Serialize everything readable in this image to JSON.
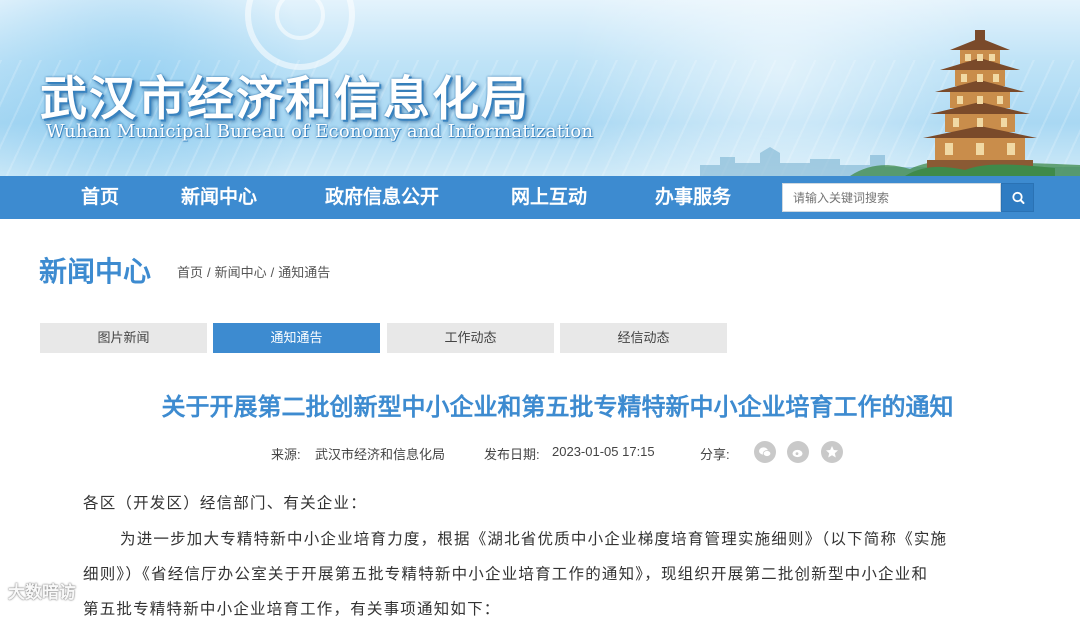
{
  "header": {
    "title": "武汉市经济和信息化局",
    "subtitle": "Wuhan Municipal Bureau of Economy and Informatization"
  },
  "nav": {
    "items": [
      "首页",
      "新闻中心",
      "政府信息公开",
      "网上互动",
      "办事服务"
    ],
    "search_placeholder": "请输入关键词搜索"
  },
  "section": {
    "title": "新闻中心",
    "breadcrumb": [
      "首页",
      "新闻中心",
      "通知通告"
    ]
  },
  "tabs": [
    {
      "label": "图片新闻",
      "active": false
    },
    {
      "label": "通知通告",
      "active": true
    },
    {
      "label": "工作动态",
      "active": false
    },
    {
      "label": "经信动态",
      "active": false
    }
  ],
  "article": {
    "title": "关于开展第二批创新型中小企业和第五批专精特新中小企业培育工作的通知",
    "source_label": "来源:",
    "source": "武汉市经济和信息化局",
    "date_label": "发布日期:",
    "date": "2023-01-05 17:15",
    "share_label": "分享:",
    "share_icons": [
      "wechat-icon",
      "weibo-icon",
      "star-icon"
    ],
    "lines": [
      "各区（开发区）经信部门、有关企业：",
      "为进一步加大专精特新中小企业培育力度，根据《湖北省优质中小企业梯度培育管理实施细则》（以下简称《实施",
      "细则》）《省经信厅办公室关于开展第五批专精特新中小企业培育工作的通知》，现组织开展第二批创新型中小企业和",
      "第五批专精特新中小企业培育工作，有关事项通知如下："
    ]
  },
  "watermark": "大数暗访"
}
